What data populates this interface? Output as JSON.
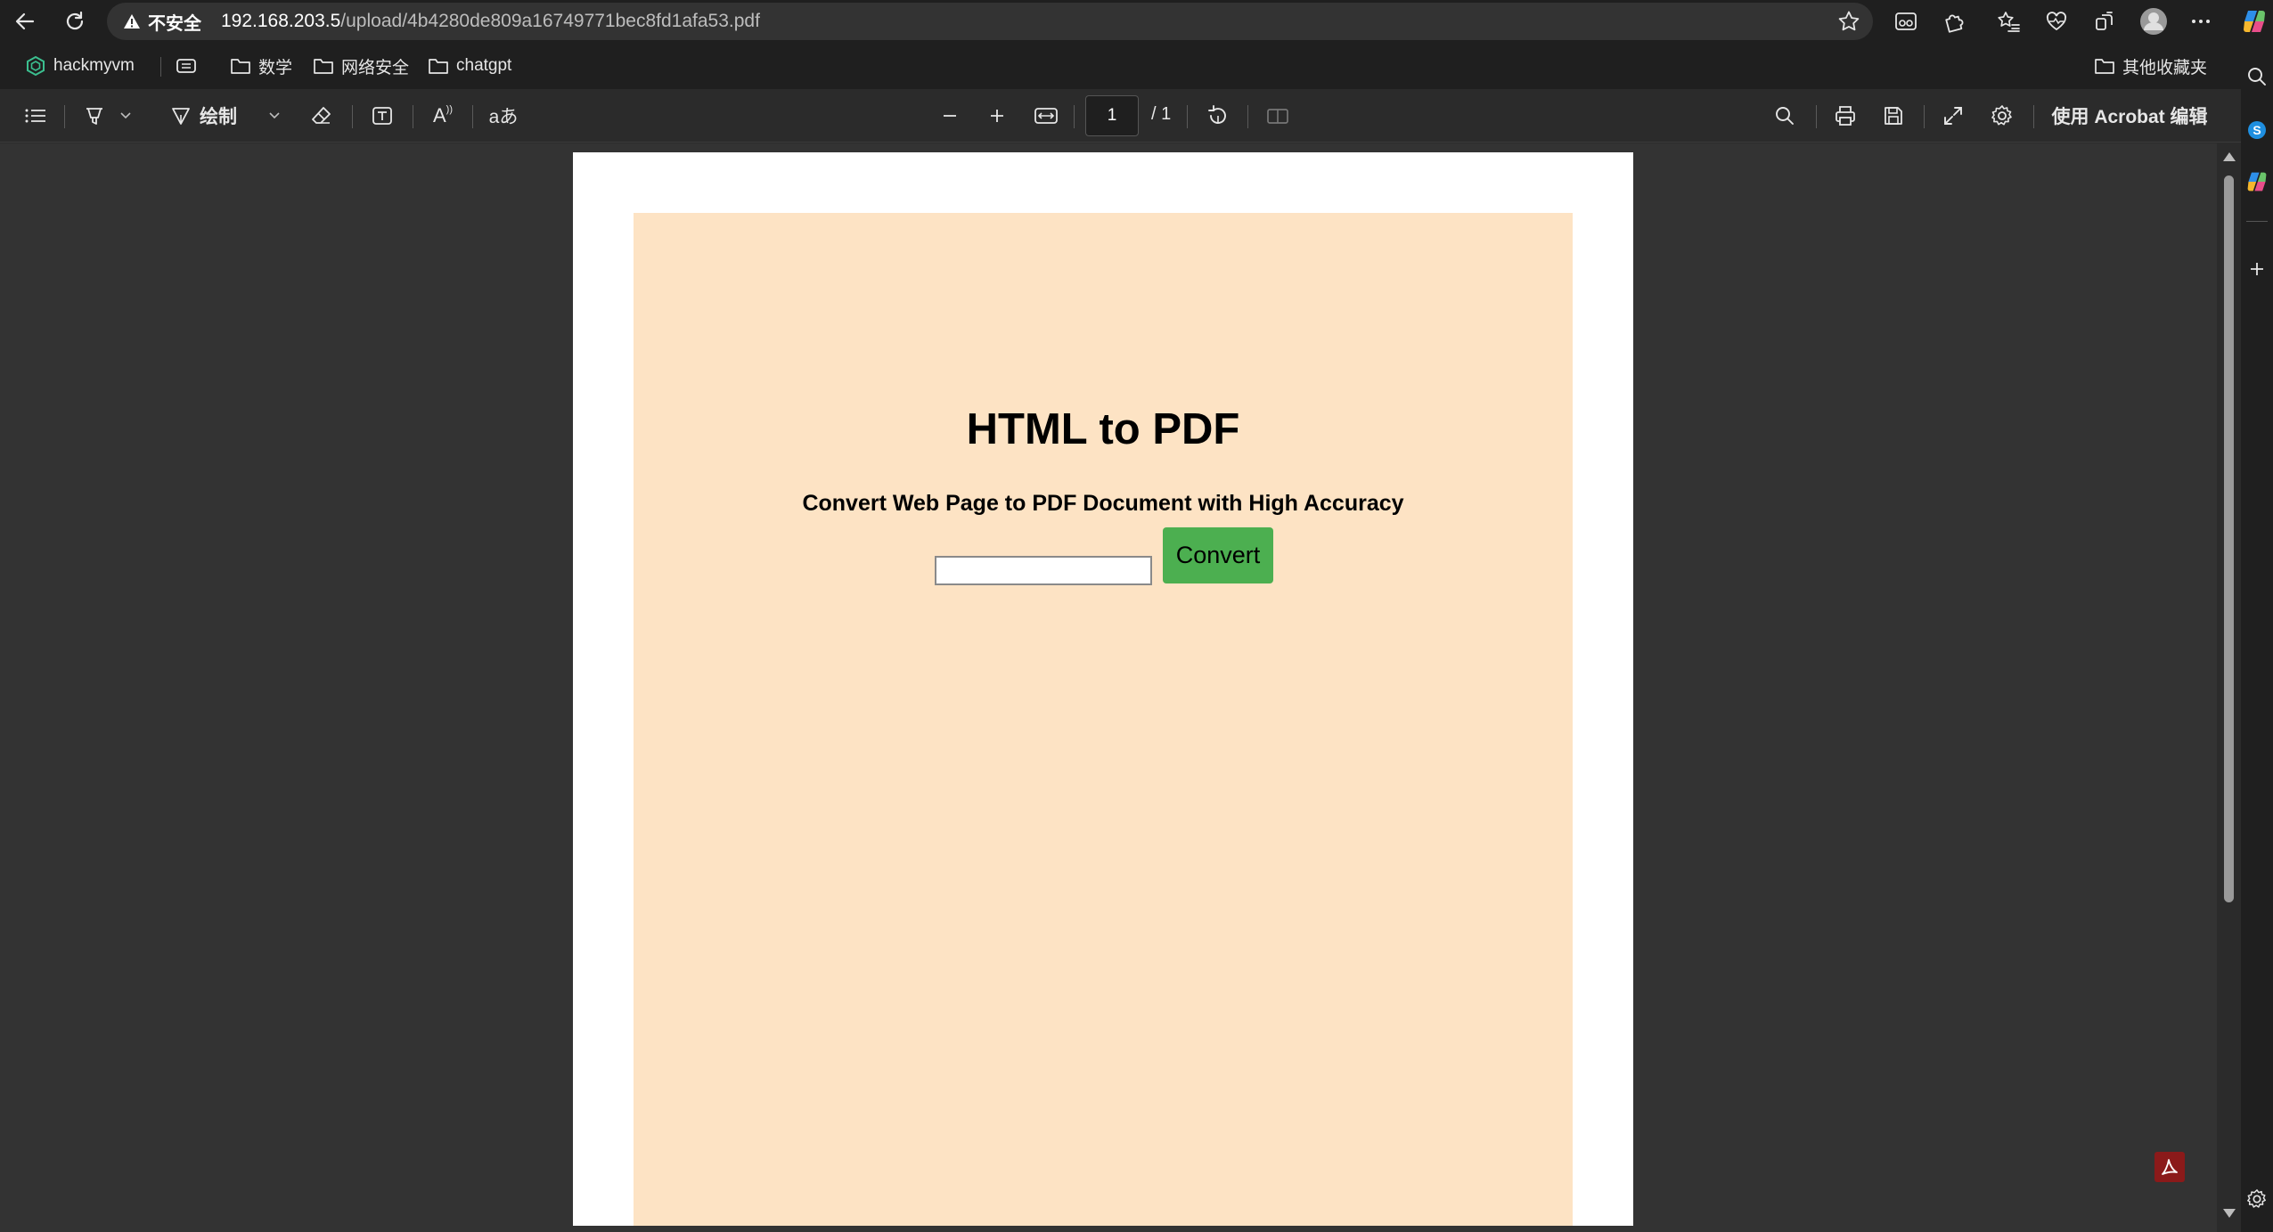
{
  "browser": {
    "insecure_label": "不安全",
    "url_host": "192.168.203.5",
    "url_path": "/upload/4b4280de809a16749771bec8fd1afa53.pdf"
  },
  "bookmarks": {
    "items": [
      {
        "label": "hackmyvm",
        "icon": "hackmyvm-icon"
      },
      {
        "label": "数学",
        "icon": "folder-icon"
      },
      {
        "label": "网络安全",
        "icon": "folder-icon"
      },
      {
        "label": "chatgpt",
        "icon": "folder-icon"
      }
    ],
    "other": "其他收藏夹"
  },
  "pdf_toolbar": {
    "draw_label": "绘制",
    "read_aloud_glyph": "A",
    "translate_glyph": "aあ",
    "page_current": "1",
    "page_total": "/ 1",
    "acrobat_label": "使用 Acrobat 编辑"
  },
  "document": {
    "title": "HTML to PDF",
    "subtitle": "Convert Web Page to PDF Document with High Accuracy",
    "input_value": "",
    "button_label": "Convert",
    "background_color": "#fde3c4",
    "button_color": "#4caf50"
  }
}
